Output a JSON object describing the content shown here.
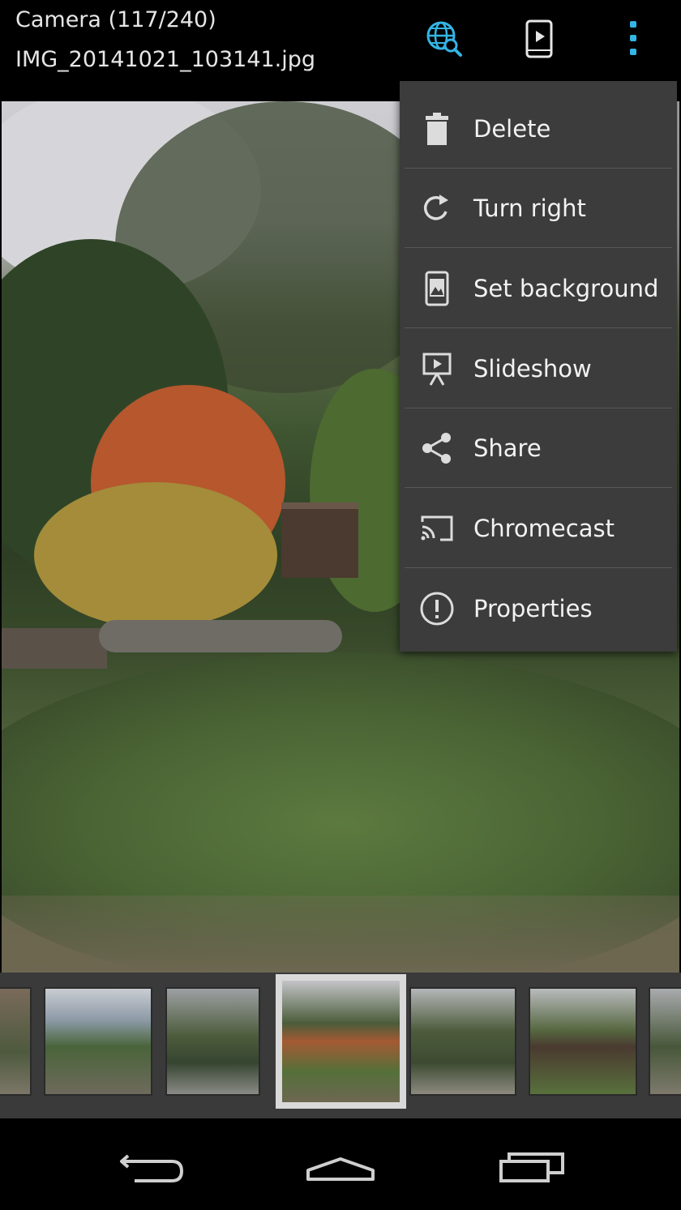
{
  "header": {
    "album": "Camera (117/240)",
    "filename": "IMG_20141021_103141.jpg"
  },
  "toolbar": {
    "icons": [
      "globe-search-icon",
      "slideshow-device-icon",
      "overflow-menu-icon"
    ],
    "accent": "#33b5e5"
  },
  "menu": {
    "items": [
      {
        "label": "Delete",
        "icon": "trash-icon"
      },
      {
        "label": "Turn right",
        "icon": "rotate-right-icon"
      },
      {
        "label": "Set background",
        "icon": "wallpaper-icon"
      },
      {
        "label": "Slideshow",
        "icon": "slideshow-icon"
      },
      {
        "label": "Share",
        "icon": "share-icon"
      },
      {
        "label": "Chromecast",
        "icon": "cast-icon"
      },
      {
        "label": "Properties",
        "icon": "info-icon"
      }
    ]
  },
  "filmstrip": {
    "count": 7,
    "selected": 3
  },
  "navbar": {
    "icons": [
      "back-icon",
      "home-icon",
      "recents-icon"
    ]
  }
}
